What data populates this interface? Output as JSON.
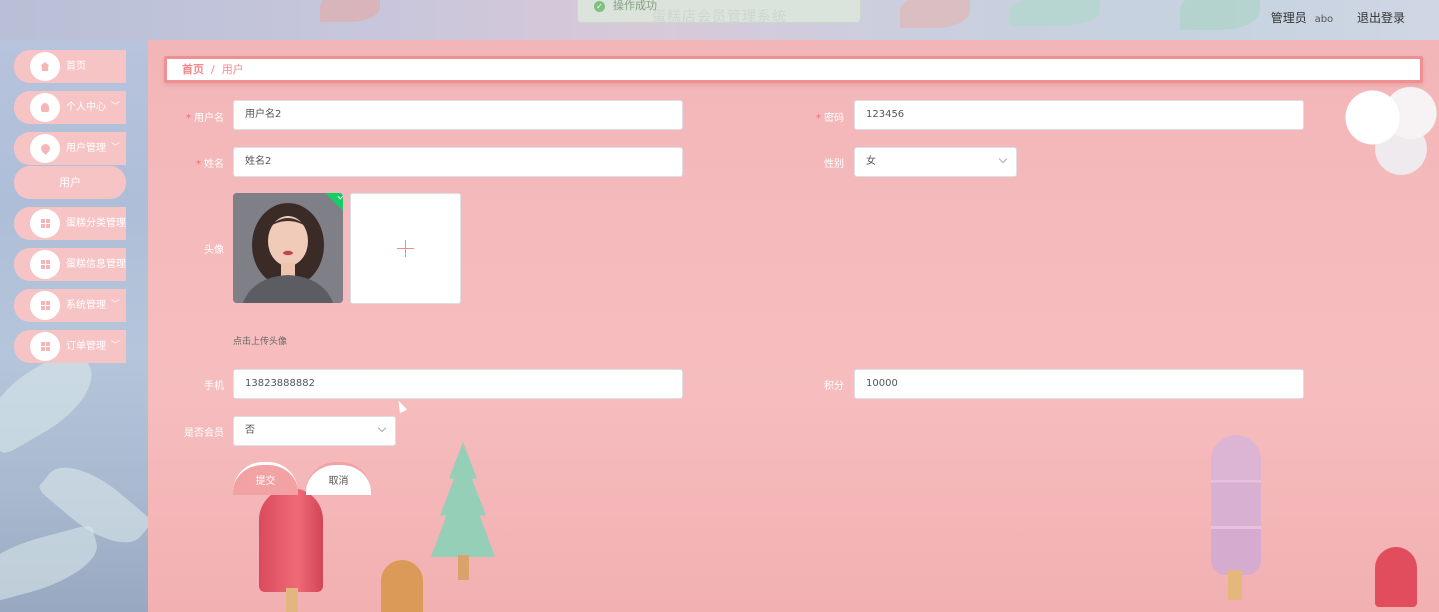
{
  "header": {
    "system_title": "蛋糕店会员管理系统",
    "toast": "操作成功",
    "role": "管理员",
    "username": "abo",
    "logout": "退出登录"
  },
  "sidebar": {
    "items": [
      {
        "label": "首页",
        "icon": "home-icon"
      },
      {
        "label": "个人中心",
        "icon": "user-icon",
        "chevron": "﹀"
      },
      {
        "label": "用户管理",
        "icon": "pin-icon",
        "chevron": "﹀"
      },
      {
        "label": "蛋糕分类管理",
        "icon": "grid-icon"
      },
      {
        "label": "蛋糕信息管理",
        "icon": "grid-icon"
      },
      {
        "label": "系统管理",
        "icon": "grid-icon",
        "chevron": "﹀"
      },
      {
        "label": "订单管理",
        "icon": "grid-icon",
        "chevron": "﹀"
      }
    ],
    "sub_item": "用户"
  },
  "breadcrumb": {
    "home": "首页",
    "separator": "/",
    "current": "用户"
  },
  "form": {
    "username_label": "用户名",
    "username_value": "用户名2",
    "password_label": "密码",
    "password_value": "123456",
    "name_label": "姓名",
    "name_value": "姓名2",
    "gender_label": "性别",
    "gender_value": "女",
    "avatar_label": "头像",
    "avatar_hint": "点击上传头像",
    "phone_label": "手机",
    "phone_value": "13823888882",
    "points_label": "积分",
    "points_value": "10000",
    "member_label": "是否会员",
    "member_value": "否",
    "required_mark": "*",
    "submit": "提交",
    "cancel": "取消"
  },
  "colors": {
    "accent": "#f08a8c",
    "sidebar_item": "#f7c4c6",
    "success": "#13ce66"
  }
}
